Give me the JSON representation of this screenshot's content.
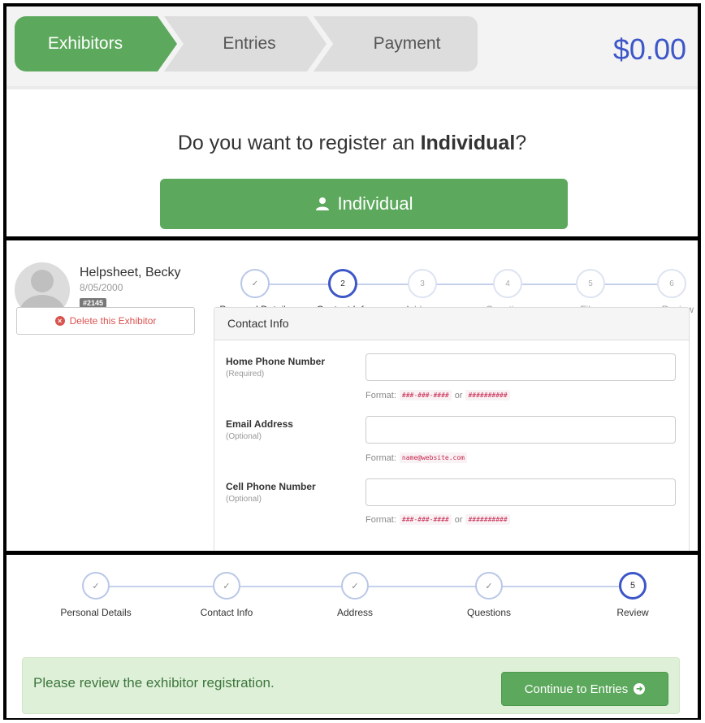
{
  "breadcrumbs": {
    "exhibitors": "Exhibitors",
    "entries": "Entries",
    "payment": "Payment",
    "total": "$0.00"
  },
  "register": {
    "question_prefix": "Do you want to register an ",
    "question_bold": "Individual",
    "question_suffix": "?",
    "button_label": "Individual",
    "button_icon": "user-icon"
  },
  "exhibitor": {
    "name": "Helpsheet, Becky",
    "dob": "8/05/2000",
    "id": "#2145",
    "delete_label": "Delete this Exhibitor"
  },
  "wizard_top": {
    "steps": [
      {
        "badge": "✓",
        "label": "Personal Details",
        "state": "done"
      },
      {
        "badge": "2",
        "label": "Contact Info",
        "state": "current"
      },
      {
        "badge": "3",
        "label": "Address",
        "state": "todo"
      },
      {
        "badge": "4",
        "label": "Questions",
        "state": "todo"
      },
      {
        "badge": "5",
        "label": "Files",
        "state": "todo"
      },
      {
        "badge": "6",
        "label": "Review",
        "state": "todo"
      }
    ]
  },
  "contact_form": {
    "title": "Contact Info",
    "format_prefix": "Format:",
    "or_word": "or",
    "fields": [
      {
        "label": "Home Phone Number",
        "note": "(Required)",
        "value": "",
        "formats": [
          "###-###-####",
          "##########"
        ]
      },
      {
        "label": "Email Address",
        "note": "(Optional)",
        "value": "",
        "formats": [
          "name@website.com"
        ]
      },
      {
        "label": "Cell Phone Number",
        "note": "(Optional)",
        "value": "",
        "formats": [
          "###-###-####",
          "##########"
        ]
      }
    ]
  },
  "wizard_bottom": {
    "steps": [
      {
        "badge": "✓",
        "label": "Personal Details",
        "state": "done"
      },
      {
        "badge": "✓",
        "label": "Contact Info",
        "state": "done"
      },
      {
        "badge": "✓",
        "label": "Address",
        "state": "done"
      },
      {
        "badge": "✓",
        "label": "Questions",
        "state": "done"
      },
      {
        "badge": "5",
        "label": "Review",
        "state": "current"
      }
    ]
  },
  "review": {
    "message": "Please review the exhibitor registration.",
    "continue_label": "Continue to Entries"
  },
  "colors": {
    "success_green": "#5ca85c",
    "accent_blue": "#3d56c8",
    "alert_bg": "#dff0d8",
    "danger": "#d9534f"
  }
}
